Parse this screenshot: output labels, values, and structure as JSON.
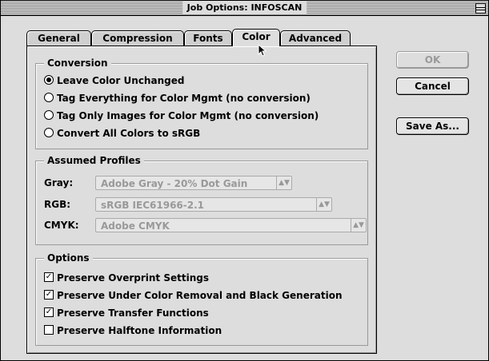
{
  "window": {
    "title": "Job Options: INFOSCAN"
  },
  "tabs": [
    {
      "label": "General"
    },
    {
      "label": "Compression"
    },
    {
      "label": "Fonts"
    },
    {
      "label": "Color",
      "active": true
    },
    {
      "label": "Advanced"
    }
  ],
  "conversion": {
    "heading": "Conversion",
    "options": [
      {
        "label": "Leave Color Unchanged",
        "selected": true
      },
      {
        "label": "Tag Everything for Color Mgmt (no conversion)",
        "selected": false
      },
      {
        "label": "Tag Only Images for Color Mgmt (no conversion)",
        "selected": false
      },
      {
        "label": "Convert All Colors to sRGB",
        "selected": false
      }
    ]
  },
  "profiles": {
    "heading": "Assumed Profiles",
    "gray": {
      "label": "Gray:",
      "value": "Adobe Gray - 20% Dot Gain"
    },
    "rgb": {
      "label": "RGB:",
      "value": "sRGB IEC61966-2.1"
    },
    "cmyk": {
      "label": "CMYK:",
      "value": "Adobe CMYK"
    }
  },
  "options": {
    "heading": "Options",
    "items": [
      {
        "label": "Preserve Overprint Settings",
        "checked": true
      },
      {
        "label": "Preserve Under Color Removal and Black Generation",
        "checked": true
      },
      {
        "label": "Preserve Transfer Functions",
        "checked": true
      },
      {
        "label": "Preserve Halftone Information",
        "checked": false
      }
    ]
  },
  "buttons": {
    "ok": "OK",
    "cancel": "Cancel",
    "save_as": "Save As..."
  }
}
